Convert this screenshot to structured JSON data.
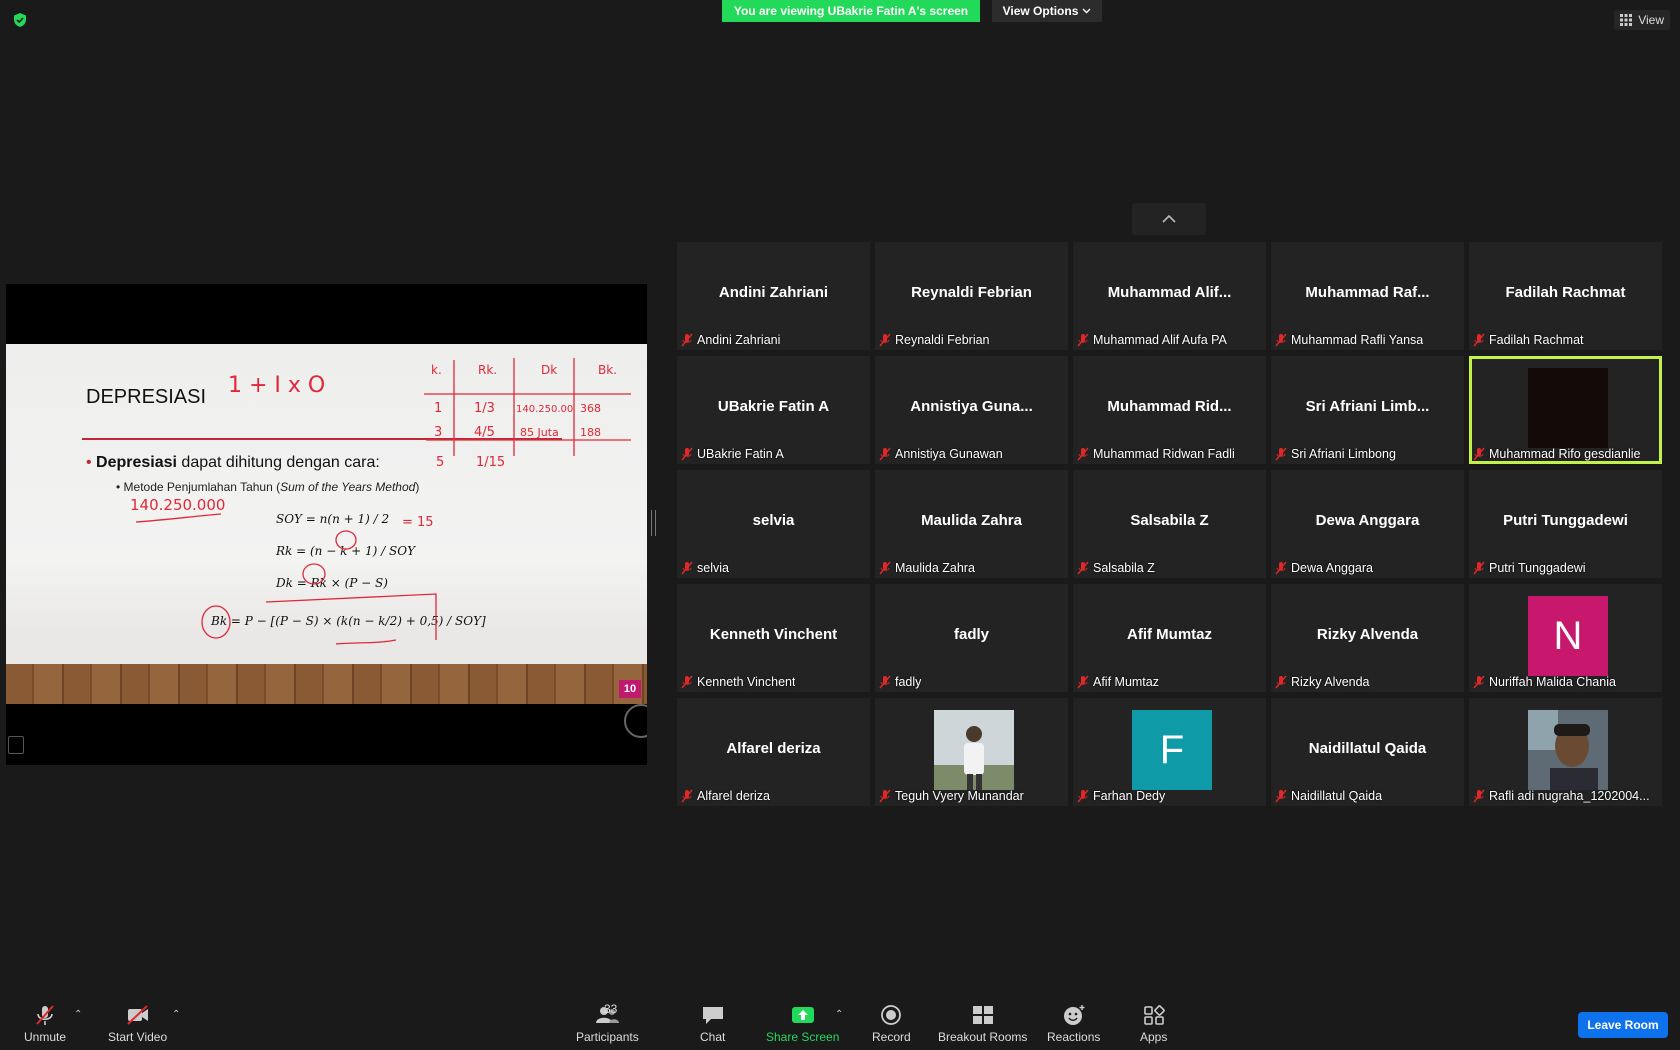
{
  "top": {
    "banner": "You are viewing UBakrie Fatin A's screen",
    "view_options": "View Options",
    "view": "View"
  },
  "slide": {
    "title": "DEPRESIASI",
    "bullet_bold": "Depresiasi",
    "bullet_rest": " dapat dihitung dengan cara:",
    "sub_prefix": "Metode Penjumlahan Tahun (",
    "sub_italic": "Sum of the Years Method",
    "sub_suffix": ")",
    "formula_soy": "SOY = n(n + 1) / 2",
    "formula_rk": "Rk = (n − k + 1) / SOY",
    "formula_dk": "Dk = Rk × (P − S)",
    "formula_bk": "Bk = P − [(P − S) × (k(n − k/2) + 0,5) / SOY]",
    "ink_top": "1 + I x O",
    "ink_amount": "140.250.000",
    "ink_soy": "= 15",
    "ink_table_headers": [
      "k.",
      "Rk.",
      "Dk",
      "Bk."
    ],
    "ink_row1": [
      "1",
      "1/3",
      "140.250.00",
      "368"
    ],
    "ink_row2": [
      "3",
      "4/5",
      "85 Juta",
      "188"
    ],
    "ink_row3": [
      "5",
      "1/15"
    ],
    "slide_number": "10"
  },
  "participants_tiles": [
    {
      "big": "Andini Zahriani",
      "label": "Andini Zahriani"
    },
    {
      "big": "Reynaldi Febrian",
      "label": "Reynaldi Febrian"
    },
    {
      "big": "Muhammad  Alif...",
      "label": "Muhammad Alif Aufa PA"
    },
    {
      "big": "Muhammad  Raf...",
      "label": "Muhammad Rafli Yansa"
    },
    {
      "big": "Fadilah Rachmat",
      "label": "Fadilah Rachmat"
    },
    {
      "big": "UBakrie Fatin A",
      "label": "UBakrie Fatin A"
    },
    {
      "big": "Annistiya  Guna...",
      "label": "Annistiya Gunawan"
    },
    {
      "big": "Muhammad  Rid...",
      "label": "Muhammad Ridwan Fadli"
    },
    {
      "big": "Sri  Afriani  Limb...",
      "label": "Sri Afriani Limbong"
    },
    {
      "big": "",
      "label": "Muhammad Rifo gesdianlie"
    },
    {
      "big": "selvia",
      "label": "selvia"
    },
    {
      "big": "Maulida Zahra",
      "label": "Maulida Zahra"
    },
    {
      "big": "Salsabila Z",
      "label": "Salsabila Z"
    },
    {
      "big": "Dewa Anggara",
      "label": "Dewa Anggara"
    },
    {
      "big": "Putri Tunggadewi",
      "label": "Putri Tunggadewi"
    },
    {
      "big": "Kenneth Vinchent",
      "label": "Kenneth Vinchent"
    },
    {
      "big": "fadly",
      "label": "fadly"
    },
    {
      "big": "Afif Mumtaz",
      "label": "Afif Mumtaz"
    },
    {
      "big": "Rizky Alvenda",
      "label": "Rizky Alvenda"
    },
    {
      "big": "",
      "label": "Nuriffah Malida Chania"
    },
    {
      "big": "Alfarel deriza",
      "label": "Alfarel deriza"
    },
    {
      "big": "",
      "label": "Teguh Vyery Munandar"
    },
    {
      "big": "",
      "label": "Farhan Dedy"
    },
    {
      "big": "Naidillatul Qaida",
      "label": "Naidillatul Qaida"
    },
    {
      "big": "",
      "label": "Rafli adi nugraha_1202004..."
    }
  ],
  "avatars": {
    "nuriffah_letter": "N",
    "nuriffah_color": "#c8186e",
    "farhan_letter": "F",
    "farhan_color": "#0e9aa7"
  },
  "toolbar": {
    "unmute": "Unmute",
    "start_video": "Start Video",
    "participants": "Participants",
    "participants_count": "33",
    "chat": "Chat",
    "share_screen": "Share Screen",
    "record": "Record",
    "breakout_rooms": "Breakout Rooms",
    "reactions": "Reactions",
    "apps": "Apps",
    "leave": "Leave Room"
  },
  "colors": {
    "banner_green": "#23d959",
    "active_speaker": "#c2f24a",
    "leave_blue": "#0e72ed",
    "mic_off_red": "#e02828"
  }
}
